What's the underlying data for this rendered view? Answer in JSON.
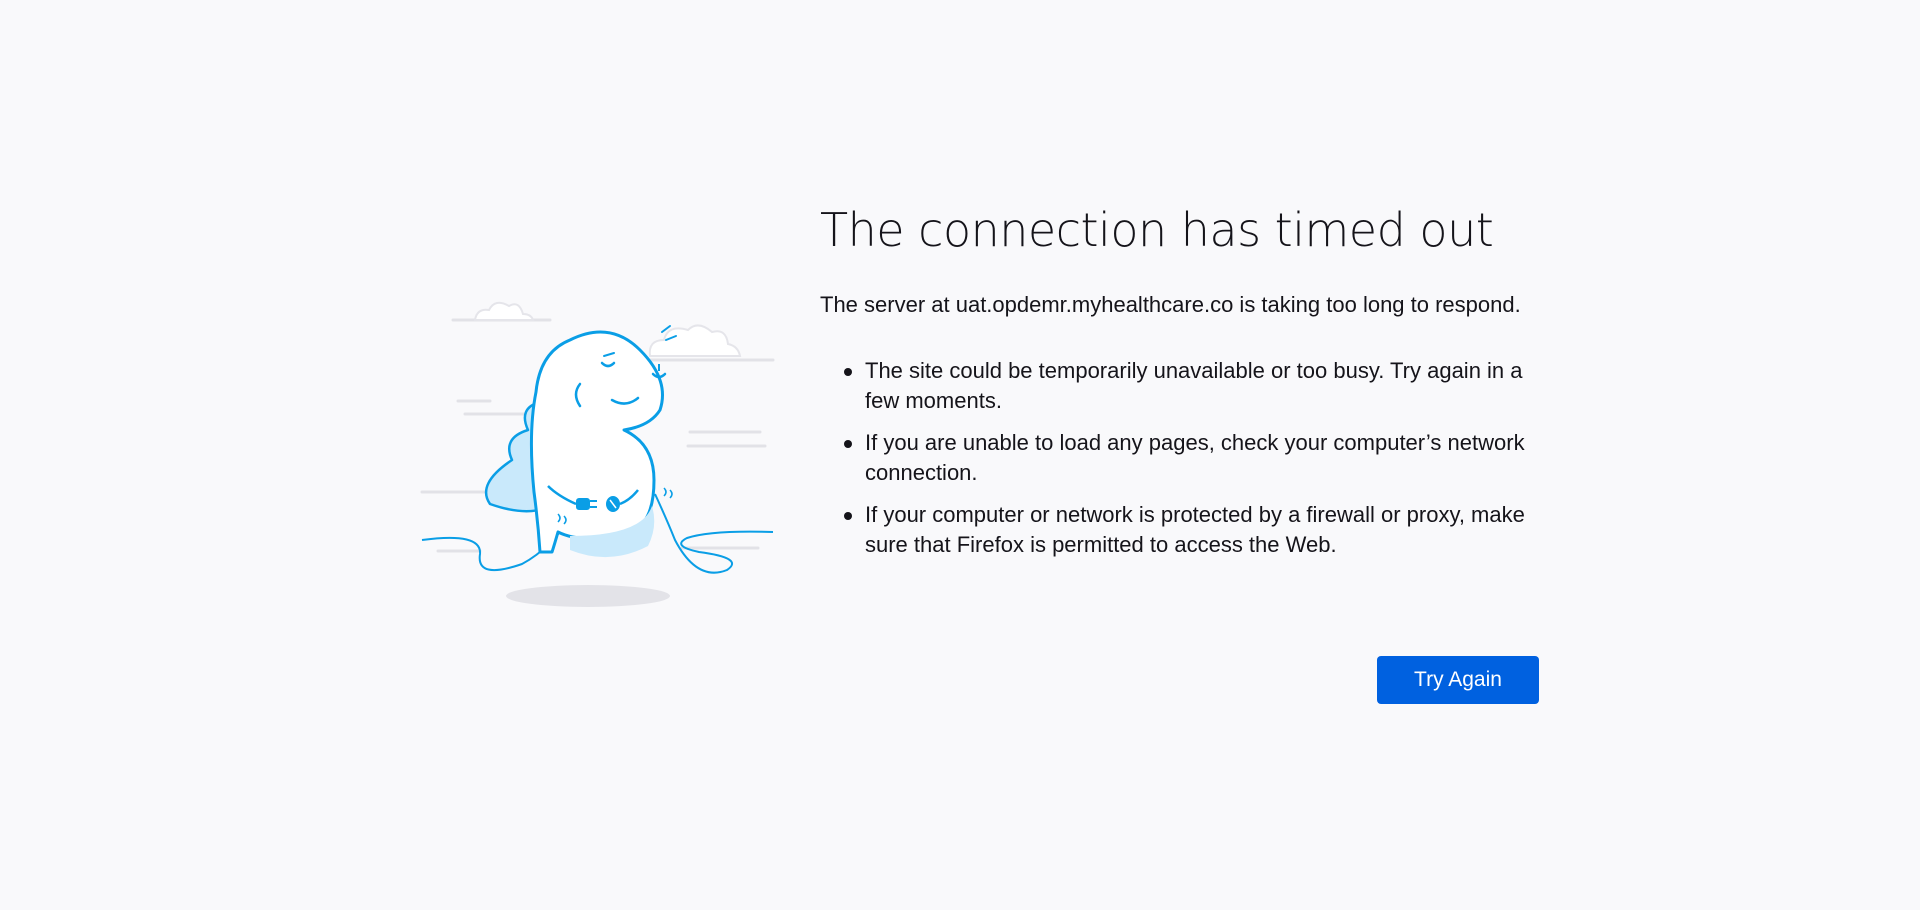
{
  "error": {
    "title": "The connection has timed out",
    "intro": "The server at uat.opdemr.myhealthcare.co is taking too long to respond.",
    "reasons": [
      "The site could be temporarily unavailable or too busy. Try again in a few moments.",
      "If you are unable to load any pages, check your computer’s network connection.",
      "If your computer or network is protected by a firewall or proxy, make sure that Firefox is permitted to access the Web."
    ],
    "try_again_label": "Try Again"
  },
  "illustration": {
    "name": "unplugged-dinosaur-illustration",
    "colors": {
      "line": "#0a9ee6",
      "fill": "#ffffff",
      "shade": "#c9e9fb",
      "shadow": "#e3e3e8",
      "clouds": "#e5e5ea"
    }
  },
  "colors": {
    "background": "#f9f9fb",
    "text": "#15141a",
    "primary_button": "#0061e0"
  }
}
